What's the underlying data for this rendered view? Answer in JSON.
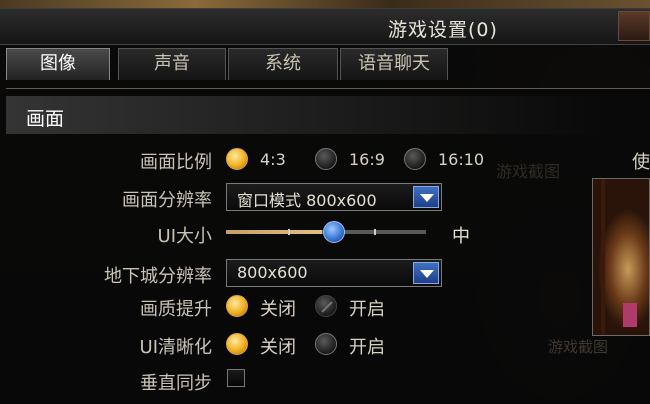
{
  "window": {
    "title": "游戏设置(0)"
  },
  "tabs": [
    {
      "label": "图像",
      "active": true
    },
    {
      "label": "声音",
      "active": false
    },
    {
      "label": "系统",
      "active": false
    },
    {
      "label": "语音聊天",
      "active": false
    }
  ],
  "section": {
    "title": "画面"
  },
  "settings": {
    "aspect_ratio": {
      "label": "画面比例",
      "options": [
        "4:3",
        "16:9",
        "16:10"
      ],
      "selected": "4:3"
    },
    "resolution": {
      "label": "画面分辨率",
      "value": "窗口模式 800x600"
    },
    "ui_size": {
      "label": "UI大小",
      "value": "中",
      "level": 0.48
    },
    "dungeon_resolution": {
      "label": "地下城分辨率",
      "value": "800x600"
    },
    "quality_boost": {
      "label": "画质提升",
      "options": [
        "关闭",
        "开启"
      ],
      "selected": "关闭"
    },
    "ui_sharpen": {
      "label": "UI清晰化",
      "options": [
        "关闭",
        "开启"
      ],
      "selected": "关闭"
    },
    "vsync": {
      "label": "垂直同步",
      "checked": false
    }
  },
  "preview": {
    "label": "使"
  },
  "watermark": {
    "text": "游戏截图",
    "text2": "游戏截图"
  },
  "colors": {
    "accent": "#f0b020",
    "dropdown_button": "#3f6fc4",
    "slider_thumb": "#3a78d8"
  },
  "icons": {
    "dropdown": "chevron-down-icon",
    "close": "close-icon"
  }
}
